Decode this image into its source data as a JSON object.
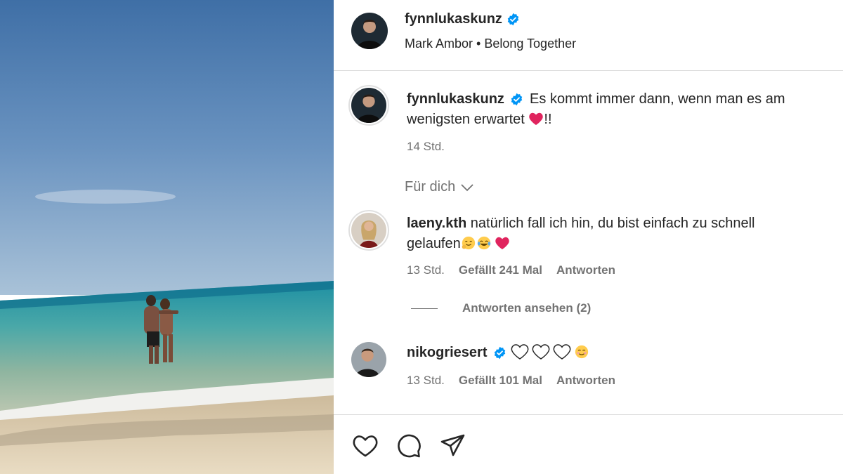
{
  "post": {
    "author": "fynnlukaskunz",
    "audio": "Mark Ambor • Belong Together"
  },
  "caption": {
    "username": "fynnlukaskunz",
    "text_part1": "Es kommt immer dann, wenn man es am",
    "text_part2": "wenigsten erwartet ",
    "text_suffix": "!!",
    "time": "14 Std."
  },
  "filter": {
    "label": "Für dich"
  },
  "comments": [
    {
      "username": "laeny.kth",
      "text_part1": "natürlich fall ich hin, du bist einfach zu schnell",
      "text_part2": "gelaufen",
      "time": "13 Std.",
      "likes": "Gefällt 241 Mal",
      "reply": "Antworten",
      "view_replies": "Antworten ansehen (2)"
    },
    {
      "username": "nikogriesert",
      "time": "13 Std.",
      "likes": "Gefällt 101 Mal",
      "reply": "Antworten"
    }
  ],
  "icons": {
    "verified": "verified-badge-icon",
    "like": "heart-outline-icon",
    "comment": "comment-bubble-icon",
    "share": "paper-plane-icon",
    "chevron": "chevron-down-icon"
  },
  "colors": {
    "verified": "#0095f6",
    "text": "#262626",
    "muted": "#737373",
    "divider": "#dbdbdb",
    "heart_emoji": "#e0245e"
  }
}
